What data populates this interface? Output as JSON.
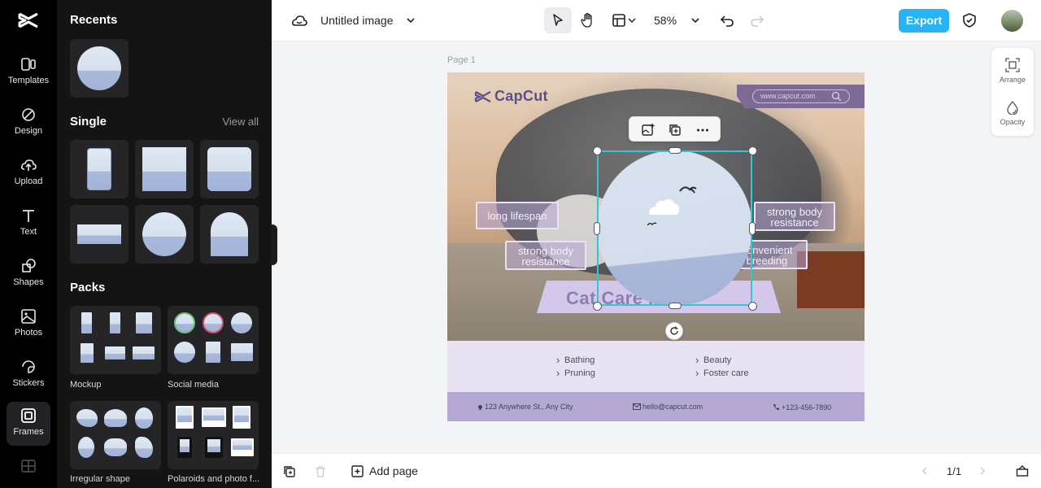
{
  "rail": {
    "items": [
      {
        "label": "Templates"
      },
      {
        "label": "Design"
      },
      {
        "label": "Upload"
      },
      {
        "label": "Text"
      },
      {
        "label": "Shapes"
      },
      {
        "label": "Photos"
      },
      {
        "label": "Stickers"
      },
      {
        "label": "Frames"
      }
    ],
    "active": "Frames"
  },
  "panel": {
    "recents_title": "Recents",
    "single_title": "Single",
    "view_all": "View all",
    "packs_title": "Packs",
    "packs": [
      {
        "label": "Mockup"
      },
      {
        "label": "Social media"
      },
      {
        "label": "Irregular shape"
      },
      {
        "label": "Polaroids and photo f..."
      }
    ]
  },
  "topbar": {
    "doc_title": "Untitled image",
    "zoom": "58%",
    "export_label": "Export"
  },
  "canvas": {
    "page_label": "Page 1",
    "design": {
      "brand": "CapCut",
      "url": "www.capcut.com",
      "bubbles": [
        "long lifespan",
        "strong body resistance",
        "strong body resistance",
        "convenient breeding"
      ],
      "title": "Cat Care Guidelines",
      "title_visible": "Cat Care        lines",
      "services_left": [
        "Bathing",
        "Pruning"
      ],
      "services_right": [
        "Beauty",
        "Foster care"
      ],
      "address": "123 Anywhere St., Any City",
      "email": "hello@capcut.com",
      "phone": "+123-456-7890"
    }
  },
  "dock": {
    "arrange": "Arrange",
    "opacity": "Opacity"
  },
  "bottombar": {
    "add_page": "Add page",
    "page_counter": "1/1"
  },
  "colors": {
    "accent": "#27b4f5",
    "selection": "#34c5d7",
    "lavender": "#e8e2f3",
    "footer": "#b5a8d3"
  }
}
